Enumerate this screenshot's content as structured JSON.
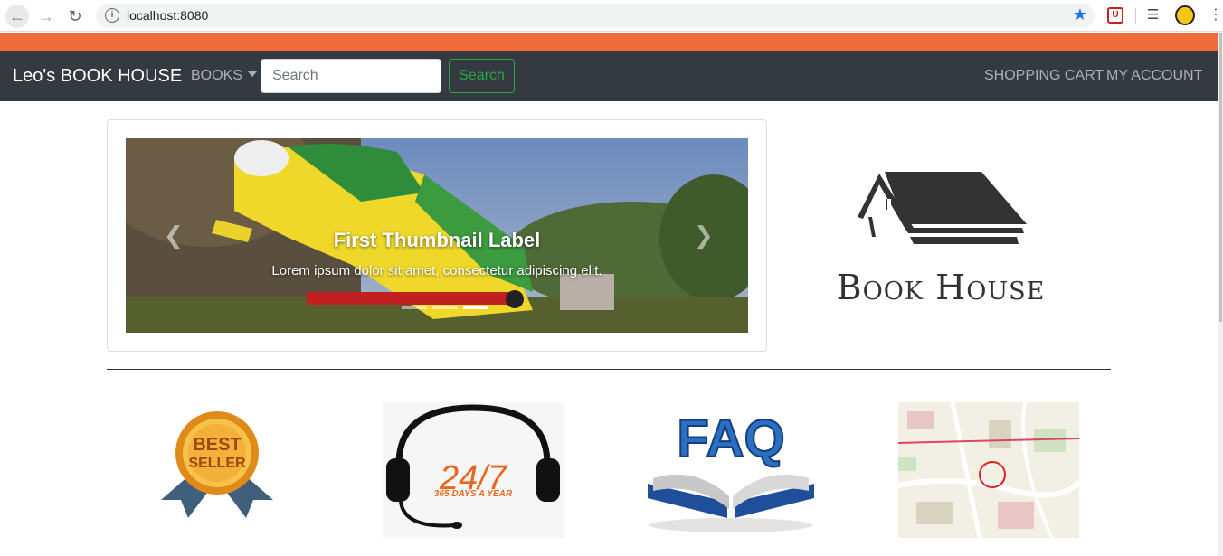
{
  "browser": {
    "url": "localhost:8080"
  },
  "navbar": {
    "brand": "Leo's BOOK HOUSE",
    "books_label": "BOOKS",
    "search_placeholder": "Search",
    "search_button": "Search",
    "cart_label": "SHOPPING CART",
    "account_label": "MY ACCOUNT"
  },
  "carousel": {
    "title": "First Thumbnail Label",
    "text": "Lorem ipsum dolor sit amet, consectetur adipiscing elit.",
    "slide_count": 3,
    "active_index": 2
  },
  "logo": {
    "text": "Book House"
  },
  "tiles": [
    {
      "name": "best-seller",
      "text_line1": "BEST",
      "text_line2": "SELLER"
    },
    {
      "name": "support-24-7",
      "big": "24/7",
      "small": "365 DAYS A YEAR"
    },
    {
      "name": "faq",
      "text": "FAQ"
    },
    {
      "name": "map"
    }
  ],
  "colors": {
    "accent_orange": "#f26b3a",
    "navbar_bg": "#343a40",
    "search_green": "#28a745"
  }
}
